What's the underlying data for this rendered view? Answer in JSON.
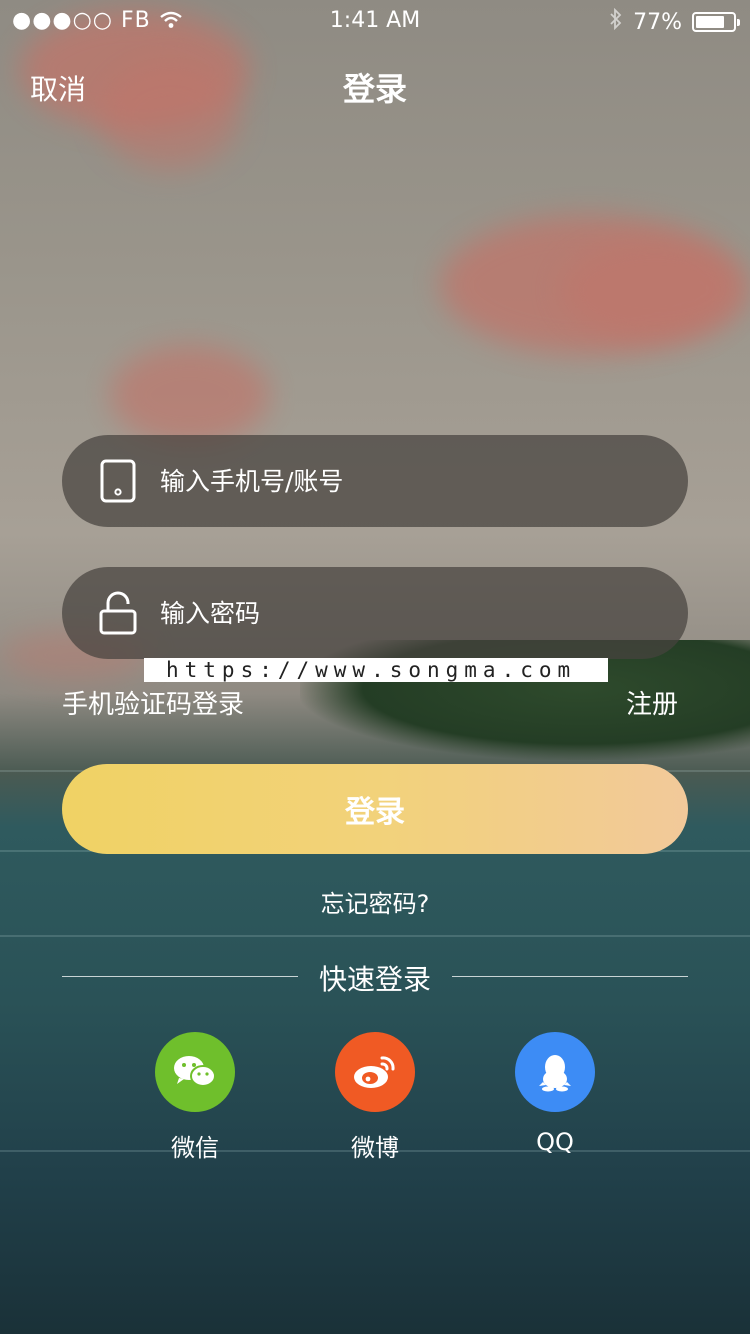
{
  "status_bar": {
    "signal": "●●●○○",
    "carrier": "FB",
    "time": "1:41 AM",
    "battery_percent": "77%",
    "battery_level": 0.77
  },
  "nav": {
    "cancel_label": "取消",
    "title": "登录"
  },
  "form": {
    "account_placeholder": "输入手机号/账号",
    "password_placeholder": "输入密码"
  },
  "watermark": "https://www.songma.com",
  "links": {
    "sms_login": "手机验证码登录",
    "register": "注册"
  },
  "login_button": "登录",
  "forgot_password": "忘记密码?",
  "quick_login": {
    "title": "快速登录",
    "options": [
      {
        "label": "微信",
        "icon": "wechat-icon",
        "color": "#6fbf2c"
      },
      {
        "label": "微博",
        "icon": "weibo-icon",
        "color": "#f05a24"
      },
      {
        "label": "QQ",
        "icon": "qq-icon",
        "color": "#3d8cf5"
      }
    ]
  },
  "colors": {
    "login_gradient_start": "#f0d264",
    "login_gradient_end": "#f2c99a",
    "field_background": "rgba(70,66,63,0.72)"
  }
}
